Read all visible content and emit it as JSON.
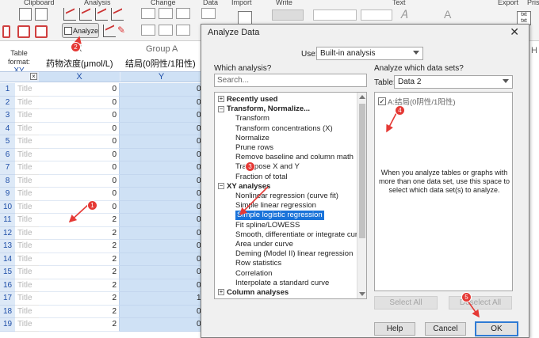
{
  "ribbon": {
    "groups": [
      "Clipboard",
      "Analysis",
      "Change",
      "Data",
      "Import",
      "Write",
      "Text",
      "Export",
      "Pris"
    ],
    "analyze_label": "Analyze"
  },
  "sheet": {
    "table_format_label": "Table format:",
    "table_format_value": "XY",
    "x_header": "X",
    "group_a_header": "Group A",
    "x_title": "药物浓度(μmol/L)",
    "y_title": "结局(0阴性/1阳性)",
    "x_col_label": "X",
    "y_col_label": "Y",
    "right_col_label": "H",
    "rows": [
      {
        "n": "1",
        "title": "Title",
        "x": "0",
        "y": "0"
      },
      {
        "n": "2",
        "title": "Title",
        "x": "0",
        "y": "0"
      },
      {
        "n": "3",
        "title": "Title",
        "x": "0",
        "y": "0"
      },
      {
        "n": "4",
        "title": "Title",
        "x": "0",
        "y": "0"
      },
      {
        "n": "5",
        "title": "Title",
        "x": "0",
        "y": "0"
      },
      {
        "n": "6",
        "title": "Title",
        "x": "0",
        "y": "0"
      },
      {
        "n": "7",
        "title": "Title",
        "x": "0",
        "y": "0"
      },
      {
        "n": "8",
        "title": "Title",
        "x": "0",
        "y": "0"
      },
      {
        "n": "9",
        "title": "Title",
        "x": "0",
        "y": "0"
      },
      {
        "n": "10",
        "title": "Title",
        "x": "0",
        "y": "0"
      },
      {
        "n": "11",
        "title": "Title",
        "x": "2",
        "y": "0"
      },
      {
        "n": "12",
        "title": "Title",
        "x": "2",
        "y": "0"
      },
      {
        "n": "13",
        "title": "Title",
        "x": "2",
        "y": "0"
      },
      {
        "n": "14",
        "title": "Title",
        "x": "2",
        "y": "0"
      },
      {
        "n": "15",
        "title": "Title",
        "x": "2",
        "y": "0"
      },
      {
        "n": "16",
        "title": "Title",
        "x": "2",
        "y": "0"
      },
      {
        "n": "17",
        "title": "Title",
        "x": "2",
        "y": "1"
      },
      {
        "n": "18",
        "title": "Title",
        "x": "2",
        "y": "0"
      },
      {
        "n": "19",
        "title": "Title",
        "x": "2",
        "y": "0"
      }
    ]
  },
  "dialog": {
    "title": "Analyze Data",
    "close": "✕",
    "use_label": "Use:",
    "use_value": "Built-in analysis",
    "which_analysis_label": "Which analysis?",
    "search_placeholder": "Search...",
    "which_datasets_label": "Analyze which data sets?",
    "table_label": "Table:",
    "table_value": "Data 2",
    "tree": [
      {
        "label": "Recently used",
        "kind": "cat",
        "pm": "+"
      },
      {
        "label": "Transform, Normalize...",
        "kind": "cat",
        "pm": "−"
      },
      {
        "label": "Transform",
        "kind": "item"
      },
      {
        "label": "Transform concentrations (X)",
        "kind": "item"
      },
      {
        "label": "Normalize",
        "kind": "item"
      },
      {
        "label": "Prune rows",
        "kind": "item"
      },
      {
        "label": "Remove baseline and column math",
        "kind": "item"
      },
      {
        "label": "Transpose X and Y",
        "kind": "item"
      },
      {
        "label": "Fraction of total",
        "kind": "item"
      },
      {
        "label": "XY analyses",
        "kind": "cat",
        "pm": "−"
      },
      {
        "label": "Nonlinear regression (curve fit)",
        "kind": "item"
      },
      {
        "label": "Simple linear regression",
        "kind": "item"
      },
      {
        "label": "Simple logistic regression",
        "kind": "item",
        "selected": true
      },
      {
        "label": "Fit spline/LOWESS",
        "kind": "item"
      },
      {
        "label": "Smooth, differentiate or integrate curve",
        "kind": "item"
      },
      {
        "label": "Area under curve",
        "kind": "item"
      },
      {
        "label": "Deming (Model II) linear regression",
        "kind": "item"
      },
      {
        "label": "Row statistics",
        "kind": "item"
      },
      {
        "label": "Correlation",
        "kind": "item"
      },
      {
        "label": "Interpolate a standard curve",
        "kind": "item"
      },
      {
        "label": "Column analyses",
        "kind": "cat",
        "pm": "+"
      }
    ],
    "dataset_item": "A:结局(0阴性/1阳性)",
    "dataset_note": "When you analyze tables or graphs with more than one data set, use this space to select which data set(s) to analyze.",
    "select_all": "Select All",
    "deselect_all": "Deselect All",
    "help": "Help",
    "cancel": "Cancel",
    "ok": "OK"
  },
  "annotations": [
    "1",
    "2",
    "3",
    "4",
    "5"
  ],
  "colors": {
    "badge": "#e53935",
    "selection": "#1a73d9",
    "y_column": "#cfe1f5",
    "row_number": "#dde9f7"
  }
}
